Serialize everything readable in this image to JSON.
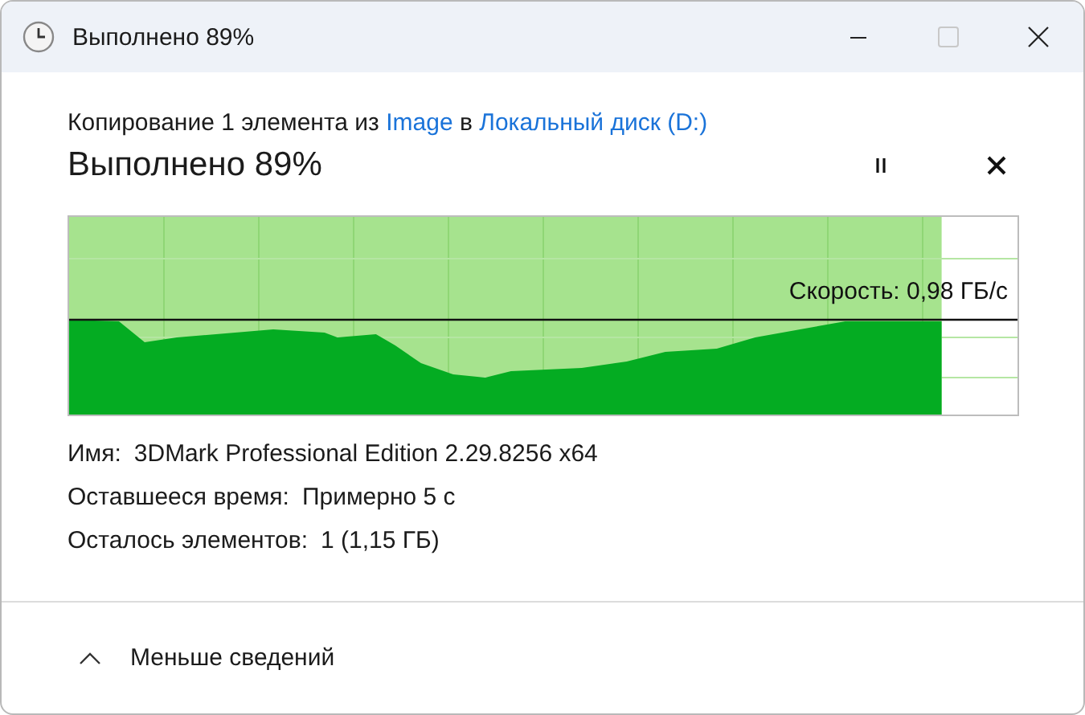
{
  "window": {
    "title": "Выполнено 89%",
    "maximize_disabled": true
  },
  "copy_line": [
    {
      "kind": "text",
      "text": "Копирование 1 элемента из "
    },
    {
      "kind": "link",
      "text": "Image"
    },
    {
      "kind": "text",
      "text": " в "
    },
    {
      "kind": "link",
      "text": "Локальный диск (D:)"
    }
  ],
  "progress": {
    "heading": "Выполнено 89%",
    "level": 0.92,
    "speed": "Скорость: 0,98 ГБ/с"
  },
  "details": [
    {
      "label": "Имя:",
      "value": "3DMark Professional Edition 2.29.8256 x64"
    },
    {
      "label": "Оставшееся время:",
      "value": "Примерно 5 с"
    },
    {
      "label": "Осталось элементов:",
      "value": "1 (1,15 ГБ)"
    }
  ],
  "footer": {
    "toggle": "Меньше сведений"
  }
}
